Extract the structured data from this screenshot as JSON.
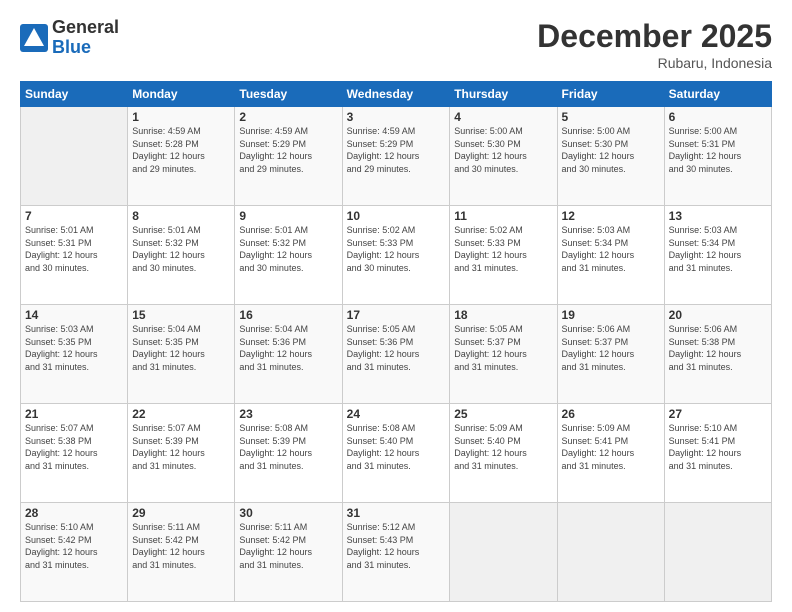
{
  "logo": {
    "general": "General",
    "blue": "Blue"
  },
  "header": {
    "title": "December 2025",
    "location": "Rubaru, Indonesia"
  },
  "weekdays": [
    "Sunday",
    "Monday",
    "Tuesday",
    "Wednesday",
    "Thursday",
    "Friday",
    "Saturday"
  ],
  "weeks": [
    [
      {
        "day": "",
        "info": ""
      },
      {
        "day": "1",
        "info": "Sunrise: 4:59 AM\nSunset: 5:28 PM\nDaylight: 12 hours\nand 29 minutes."
      },
      {
        "day": "2",
        "info": "Sunrise: 4:59 AM\nSunset: 5:29 PM\nDaylight: 12 hours\nand 29 minutes."
      },
      {
        "day": "3",
        "info": "Sunrise: 4:59 AM\nSunset: 5:29 PM\nDaylight: 12 hours\nand 29 minutes."
      },
      {
        "day": "4",
        "info": "Sunrise: 5:00 AM\nSunset: 5:30 PM\nDaylight: 12 hours\nand 30 minutes."
      },
      {
        "day": "5",
        "info": "Sunrise: 5:00 AM\nSunset: 5:30 PM\nDaylight: 12 hours\nand 30 minutes."
      },
      {
        "day": "6",
        "info": "Sunrise: 5:00 AM\nSunset: 5:31 PM\nDaylight: 12 hours\nand 30 minutes."
      }
    ],
    [
      {
        "day": "7",
        "info": "Sunrise: 5:01 AM\nSunset: 5:31 PM\nDaylight: 12 hours\nand 30 minutes."
      },
      {
        "day": "8",
        "info": "Sunrise: 5:01 AM\nSunset: 5:32 PM\nDaylight: 12 hours\nand 30 minutes."
      },
      {
        "day": "9",
        "info": "Sunrise: 5:01 AM\nSunset: 5:32 PM\nDaylight: 12 hours\nand 30 minutes."
      },
      {
        "day": "10",
        "info": "Sunrise: 5:02 AM\nSunset: 5:33 PM\nDaylight: 12 hours\nand 30 minutes."
      },
      {
        "day": "11",
        "info": "Sunrise: 5:02 AM\nSunset: 5:33 PM\nDaylight: 12 hours\nand 31 minutes."
      },
      {
        "day": "12",
        "info": "Sunrise: 5:03 AM\nSunset: 5:34 PM\nDaylight: 12 hours\nand 31 minutes."
      },
      {
        "day": "13",
        "info": "Sunrise: 5:03 AM\nSunset: 5:34 PM\nDaylight: 12 hours\nand 31 minutes."
      }
    ],
    [
      {
        "day": "14",
        "info": "Sunrise: 5:03 AM\nSunset: 5:35 PM\nDaylight: 12 hours\nand 31 minutes."
      },
      {
        "day": "15",
        "info": "Sunrise: 5:04 AM\nSunset: 5:35 PM\nDaylight: 12 hours\nand 31 minutes."
      },
      {
        "day": "16",
        "info": "Sunrise: 5:04 AM\nSunset: 5:36 PM\nDaylight: 12 hours\nand 31 minutes."
      },
      {
        "day": "17",
        "info": "Sunrise: 5:05 AM\nSunset: 5:36 PM\nDaylight: 12 hours\nand 31 minutes."
      },
      {
        "day": "18",
        "info": "Sunrise: 5:05 AM\nSunset: 5:37 PM\nDaylight: 12 hours\nand 31 minutes."
      },
      {
        "day": "19",
        "info": "Sunrise: 5:06 AM\nSunset: 5:37 PM\nDaylight: 12 hours\nand 31 minutes."
      },
      {
        "day": "20",
        "info": "Sunrise: 5:06 AM\nSunset: 5:38 PM\nDaylight: 12 hours\nand 31 minutes."
      }
    ],
    [
      {
        "day": "21",
        "info": "Sunrise: 5:07 AM\nSunset: 5:38 PM\nDaylight: 12 hours\nand 31 minutes."
      },
      {
        "day": "22",
        "info": "Sunrise: 5:07 AM\nSunset: 5:39 PM\nDaylight: 12 hours\nand 31 minutes."
      },
      {
        "day": "23",
        "info": "Sunrise: 5:08 AM\nSunset: 5:39 PM\nDaylight: 12 hours\nand 31 minutes."
      },
      {
        "day": "24",
        "info": "Sunrise: 5:08 AM\nSunset: 5:40 PM\nDaylight: 12 hours\nand 31 minutes."
      },
      {
        "day": "25",
        "info": "Sunrise: 5:09 AM\nSunset: 5:40 PM\nDaylight: 12 hours\nand 31 minutes."
      },
      {
        "day": "26",
        "info": "Sunrise: 5:09 AM\nSunset: 5:41 PM\nDaylight: 12 hours\nand 31 minutes."
      },
      {
        "day": "27",
        "info": "Sunrise: 5:10 AM\nSunset: 5:41 PM\nDaylight: 12 hours\nand 31 minutes."
      }
    ],
    [
      {
        "day": "28",
        "info": "Sunrise: 5:10 AM\nSunset: 5:42 PM\nDaylight: 12 hours\nand 31 minutes."
      },
      {
        "day": "29",
        "info": "Sunrise: 5:11 AM\nSunset: 5:42 PM\nDaylight: 12 hours\nand 31 minutes."
      },
      {
        "day": "30",
        "info": "Sunrise: 5:11 AM\nSunset: 5:42 PM\nDaylight: 12 hours\nand 31 minutes."
      },
      {
        "day": "31",
        "info": "Sunrise: 5:12 AM\nSunset: 5:43 PM\nDaylight: 12 hours\nand 31 minutes."
      },
      {
        "day": "",
        "info": ""
      },
      {
        "day": "",
        "info": ""
      },
      {
        "day": "",
        "info": ""
      }
    ]
  ]
}
